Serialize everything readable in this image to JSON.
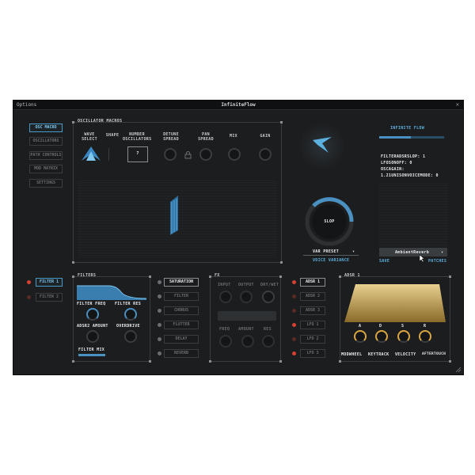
{
  "window": {
    "title": "InfiniteFlow",
    "menu": "Options",
    "close": "✕"
  },
  "nav": {
    "items": [
      {
        "label": "OSC MACRO",
        "active": true
      },
      {
        "label": "OSCILLATORS"
      },
      {
        "label": "PATH CONTROLS"
      },
      {
        "label": "MOD MATRIX"
      },
      {
        "label": "SETTINGS"
      }
    ]
  },
  "osc": {
    "section_title": "OSCILLATOR MACROS",
    "wave_select": "WAVE\nSELECT",
    "shape": "SHAPE",
    "number_osc": "NUMBER\nOSCILLATORS",
    "number_value": "7",
    "detune_spread": "DETUNE\nSPREAD",
    "pan_spread": "PAN\nSPREAD",
    "mix": "MIX",
    "gain": "GAIN"
  },
  "right": {
    "brand": "INFINITE FLOW",
    "status_lines": [
      "FILTERADSRSLOP: 1",
      "LFOSONOFF: 0",
      "OSCAGAIN:",
      "1.21UNISONVOICEMODE: 0"
    ],
    "slop_label": "SLOP",
    "var_preset": "VAR PRESET",
    "var_arrow": "▾",
    "voice_variance": "VOICE VARIANCE",
    "patch_name": "AmbientReverb",
    "patch_arrow": "▾",
    "save": "SAVE",
    "patches": "PATCHES"
  },
  "filters": {
    "tabs": [
      "FILTER 1",
      "FILTER 2"
    ],
    "section_title": "FILTERS",
    "filter_freq": "FILTER FREQ",
    "filter_res": "FILTER RES",
    "adsr2_amount": "ADSR2 AMOUNT",
    "overdrive": "OVERDRIVE",
    "filter_mix": "FILTER MIX"
  },
  "fx": {
    "section_title": "FX",
    "items": [
      "SATURATION",
      "FILTER",
      "CHORUS",
      "FLUTTER",
      "DELAY",
      "REVERB"
    ],
    "top_labels": [
      "INPUT",
      "OUTPUT",
      "DRY/WET"
    ],
    "bottom_labels": [
      "FREQ",
      "AMOUNT",
      "RES"
    ]
  },
  "adsr": {
    "tabs": [
      "ADSR 1",
      "ADSR 2",
      "ADSR 3",
      "LFO 1",
      "LFO 2",
      "LFO 3"
    ],
    "section_title": "ADSR 1",
    "knobs": [
      "A",
      "D",
      "S",
      "R"
    ],
    "mods": [
      "MODWHEEL",
      "KEYTRACK",
      "VELOCITY",
      "AFTERTOUCH"
    ]
  },
  "colors": {
    "accent": "#5cb0e0",
    "gold": "#d9a640",
    "red": "#d94030"
  }
}
